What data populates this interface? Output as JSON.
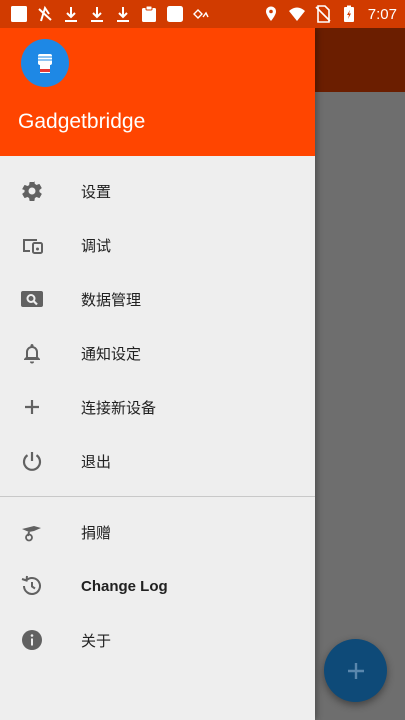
{
  "status_bar": {
    "time": "7:07",
    "left_icons": [
      "square-icon",
      "no-signal-icon",
      "download-icon",
      "download-icon",
      "download-icon",
      "clipboard-icon",
      "square-icon",
      "cast-icon"
    ],
    "right_icons": [
      "location-icon",
      "wifi-icon",
      "no-sim-icon",
      "battery-charging-icon"
    ]
  },
  "drawer": {
    "app_name": "Gadgetbridge",
    "menu_main": [
      {
        "label": "设置",
        "icon": "gear-icon"
      },
      {
        "label": "调试",
        "icon": "devices-icon"
      },
      {
        "label": "数据管理",
        "icon": "data-search-icon"
      },
      {
        "label": "通知设定",
        "icon": "bell-icon"
      },
      {
        "label": "连接新设备",
        "icon": "plus-icon"
      },
      {
        "label": "退出",
        "icon": "power-icon"
      }
    ],
    "menu_secondary": [
      {
        "label": "捐赠",
        "icon": "donate-icon"
      },
      {
        "label": "Change Log",
        "icon": "history-icon"
      },
      {
        "label": "关于",
        "icon": "info-icon"
      }
    ]
  },
  "colors": {
    "status_bar": "#d13b00",
    "drawer_header": "#ff4500",
    "drawer_bg": "#eeeeee",
    "scrim": "#6e6e6e",
    "fab": "#0e4a78"
  }
}
